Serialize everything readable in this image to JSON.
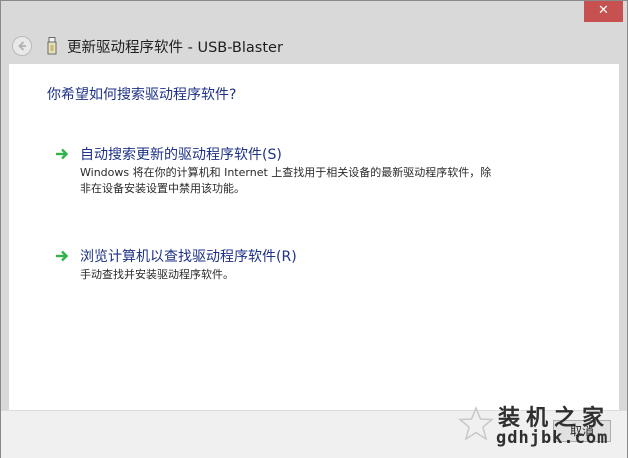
{
  "window": {
    "title": "更新驱动程序软件 - USB-Blaster",
    "close_glyph": "✕"
  },
  "main": {
    "question": "你希望如何搜索驱动程序软件?",
    "options": [
      {
        "title": "自动搜索更新的驱动程序软件(S)",
        "description": "Windows 将在你的计算机和 Internet 上查找用于相关设备的最新驱动程序软件，除非在设备安装设置中禁用该功能。"
      },
      {
        "title": "浏览计算机以查找驱动程序软件(R)",
        "description": "手动查找并安装驱动程序软件。"
      }
    ]
  },
  "footer": {
    "cancel_label": "取消"
  },
  "watermark": {
    "text": "装机之家",
    "url": "gdhjbk.com"
  },
  "colors": {
    "accent_text": "#1e3287",
    "arrow_green": "#2fb34a",
    "close_red": "#c75050"
  },
  "icons": {
    "back": "back-arrow-icon",
    "device": "usb-device-icon",
    "option_arrow": "green-arrow-icon"
  }
}
